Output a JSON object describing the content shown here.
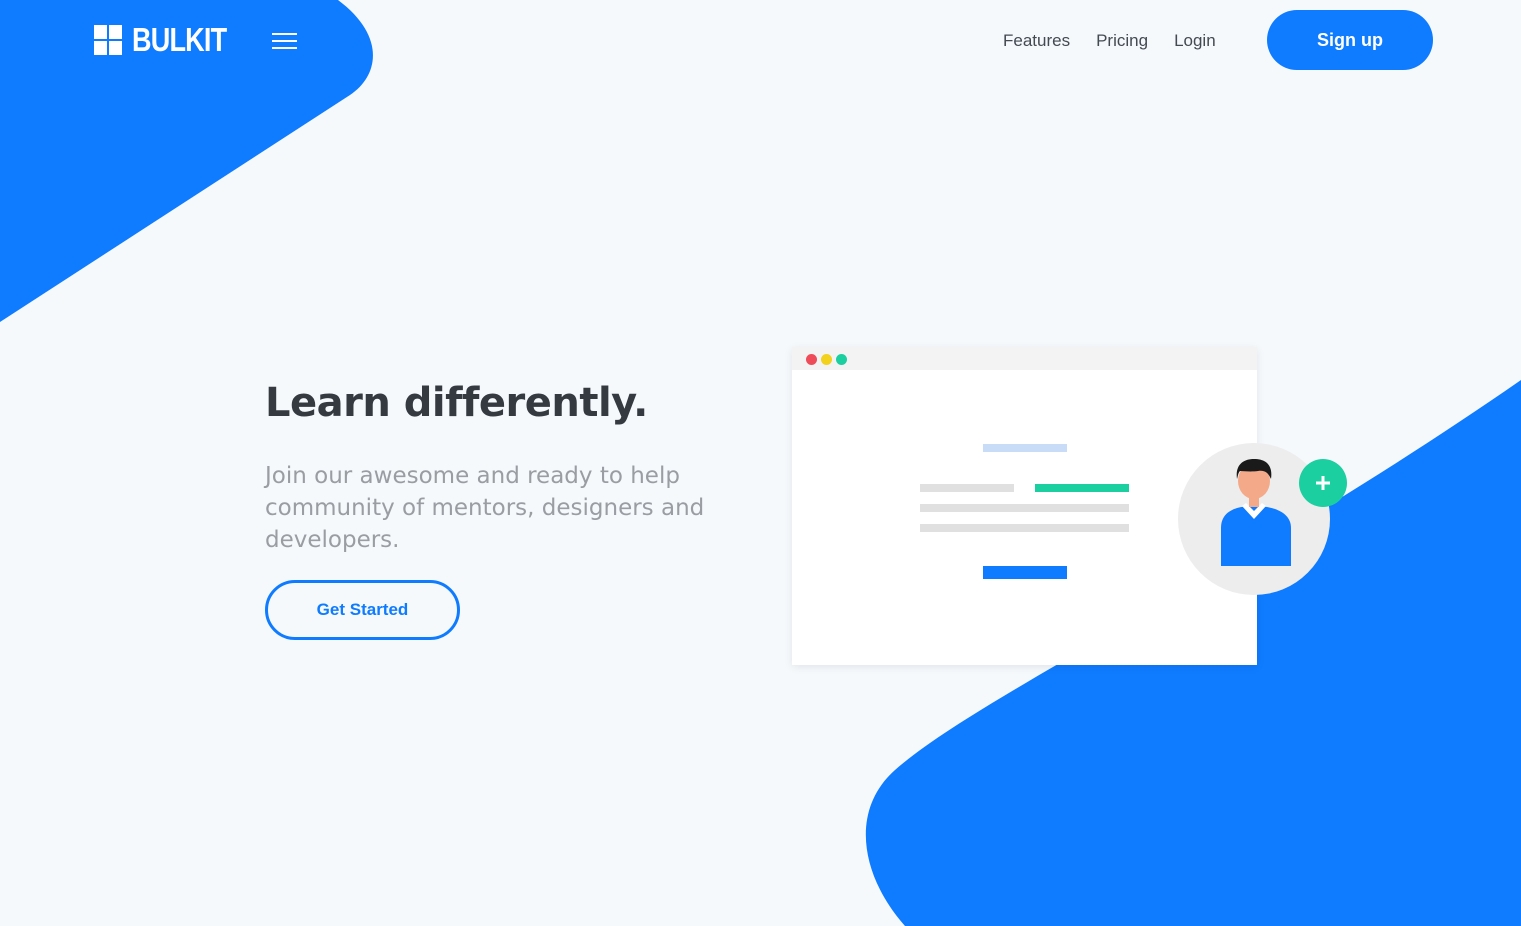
{
  "brand": {
    "name": "BULKIT",
    "icon": "grid-logo-icon",
    "color_primary": "#0f7bff",
    "color_accent": "#1ccfa0"
  },
  "nav": {
    "menu_icon": "hamburger-menu-icon",
    "links": [
      {
        "label": "Features"
      },
      {
        "label": "Pricing"
      },
      {
        "label": "Login"
      }
    ],
    "signup_label": "Sign up"
  },
  "hero": {
    "title": "Learn differently.",
    "subtitle": "Join our awesome and ready to help community of mentors, designers and developers.",
    "cta_label": "Get Started"
  },
  "illustration": {
    "window_dots": [
      "#ee4c58",
      "#f2d21c",
      "#1ccfa0"
    ],
    "avatar_icon": "user-avatar-icon",
    "badge_icon": "plus-icon"
  }
}
